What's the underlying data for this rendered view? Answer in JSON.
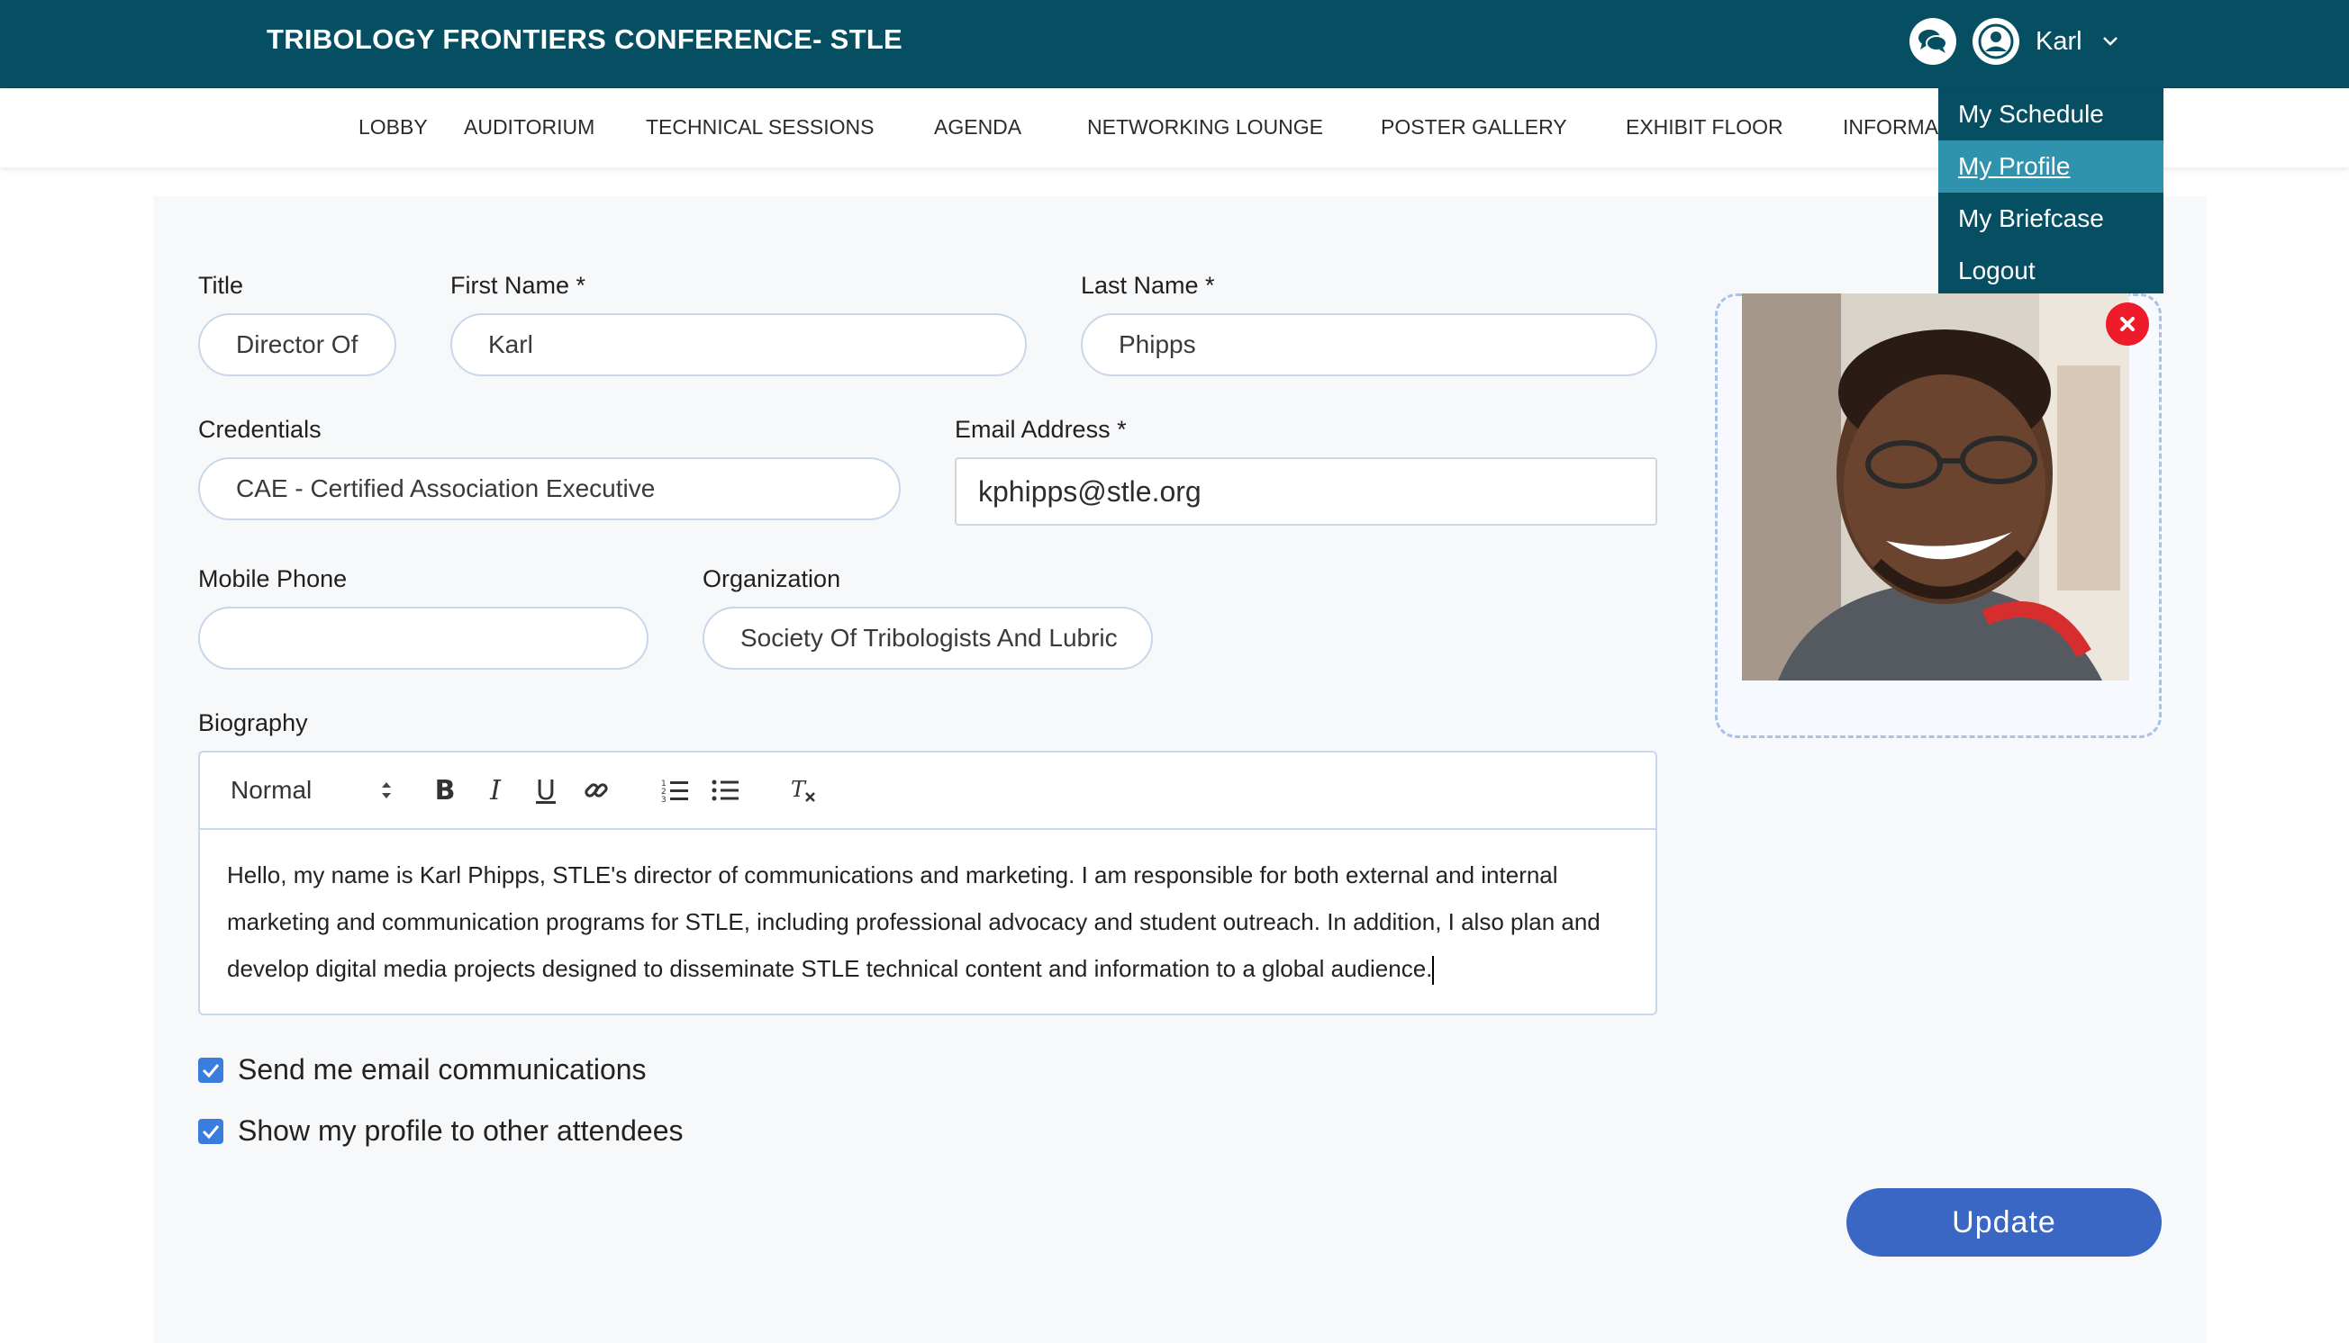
{
  "header": {
    "title": "TRIBOLOGY FRONTIERS CONFERENCE- STLE",
    "user_name": "Karl",
    "colors": {
      "bar": "#064f63",
      "accent": "#2f93ad"
    }
  },
  "nav": {
    "items": [
      "LOBBY",
      "AUDITORIUM",
      "TECHNICAL SESSIONS",
      "AGENDA",
      "NETWORKING LOUNGE",
      "POSTER GALLERY",
      "EXHIBIT FLOOR",
      "INFORMA"
    ]
  },
  "user_menu": {
    "items": [
      "My Schedule",
      "My Profile",
      "My Briefcase",
      "Logout"
    ],
    "active": "My Profile"
  },
  "form": {
    "title": {
      "label": "Title",
      "value": "Director Of"
    },
    "first_name": {
      "label": "First Name *",
      "value": "Karl"
    },
    "last_name": {
      "label": "Last Name *",
      "value": "Phipps"
    },
    "credentials": {
      "label": "Credentials",
      "value": "CAE - Certified Association Executive"
    },
    "email": {
      "label": "Email Address *",
      "value": "kphipps@stle.org"
    },
    "mobile_phone": {
      "label": "Mobile Phone",
      "value": ""
    },
    "organization": {
      "label": "Organization",
      "value": "Society Of Tribologists And Lubric"
    },
    "biography": {
      "label": "Biography",
      "format": "Normal",
      "text": "Hello, my name is Karl Phipps, STLE's director of communications and marketing. I am responsible for both external and internal marketing and communication programs for STLE, including professional advocacy and student outreach. In addition, I also plan and develop digital media projects designed to disseminate STLE technical content and information to a global audience."
    },
    "checkboxes": [
      {
        "label": "Send me email communications",
        "checked": true
      },
      {
        "label": "Show my profile to other attendees",
        "checked": true
      }
    ],
    "submit_label": "Update"
  }
}
